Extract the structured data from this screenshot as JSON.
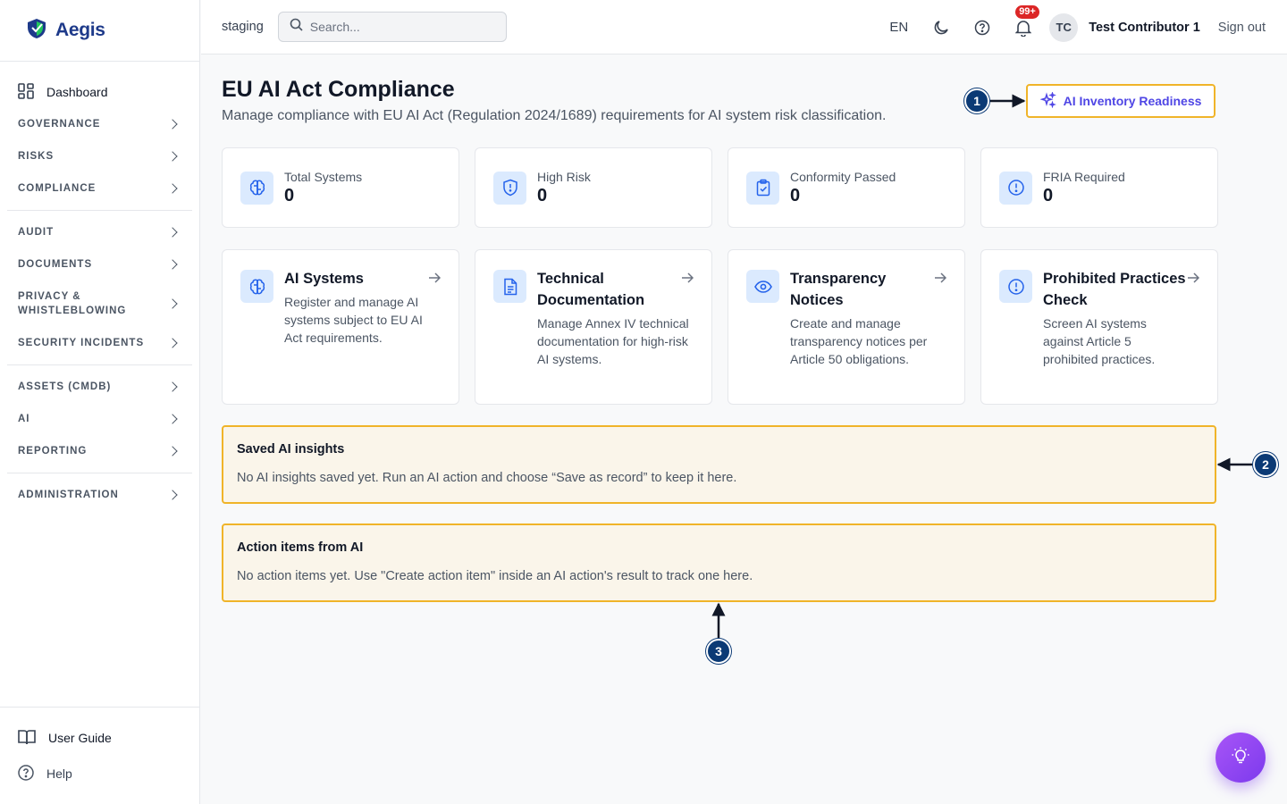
{
  "brand": {
    "name": "Aegis"
  },
  "sidebar": {
    "dashboard": "Dashboard",
    "sections": [
      "GOVERNANCE",
      "RISKS",
      "COMPLIANCE",
      "AUDIT",
      "DOCUMENTS",
      "PRIVACY & WHISTLEBLOWING",
      "SECURITY INCIDENTS",
      "ASSETS (CMDB)",
      "AI",
      "REPORTING",
      "ADMINISTRATION"
    ],
    "user_guide": "User Guide",
    "help": "Help"
  },
  "header": {
    "env": "staging",
    "search_placeholder": "Search...",
    "lang": "EN",
    "notification_count": "99+",
    "avatar_initials": "TC",
    "user_name": "Test Contributor 1",
    "sign_out": "Sign out"
  },
  "page": {
    "title": "EU AI Act Compliance",
    "subtitle": "Manage compliance with EU AI Act (Regulation 2024/1689) requirements for AI system risk classification.",
    "readiness_button": "AI Inventory Readiness"
  },
  "stats": [
    {
      "label": "Total Systems",
      "value": "0",
      "icon": "brain-icon"
    },
    {
      "label": "High Risk",
      "value": "0",
      "icon": "shield-alert-icon"
    },
    {
      "label": "Conformity Passed",
      "value": "0",
      "icon": "clipboard-check-icon"
    },
    {
      "label": "FRIA Required",
      "value": "0",
      "icon": "alert-circle-icon"
    }
  ],
  "features": [
    {
      "title": "AI Systems",
      "desc": "Register and manage AI systems subject to EU AI Act requirements.",
      "icon": "brain-icon"
    },
    {
      "title": "Technical Documentation",
      "desc": "Manage Annex IV technical documentation for high-risk AI systems.",
      "icon": "document-icon"
    },
    {
      "title": "Transparency Notices",
      "desc": "Create and manage transparency notices per Article 50 obligations.",
      "icon": "eye-icon"
    },
    {
      "title": "Prohibited Practices Check",
      "desc": "Screen AI systems against Article 5 prohibited practices.",
      "icon": "alert-circle-icon"
    }
  ],
  "panels": {
    "insights": {
      "title": "Saved AI insights",
      "text": "No AI insights saved yet. Run an AI action and choose “Save as record” to keep it here."
    },
    "actions": {
      "title": "Action items from AI",
      "text": "No action items yet. Use \"Create action item\" inside an AI action's result to track one here."
    }
  },
  "callouts": [
    "1",
    "2",
    "3"
  ],
  "colors": {
    "accent": "#4f46e5",
    "highlight": "#f0b429",
    "callout": "#0b3a75",
    "icon_bg": "#dbeafe",
    "icon_fg": "#2563eb"
  }
}
